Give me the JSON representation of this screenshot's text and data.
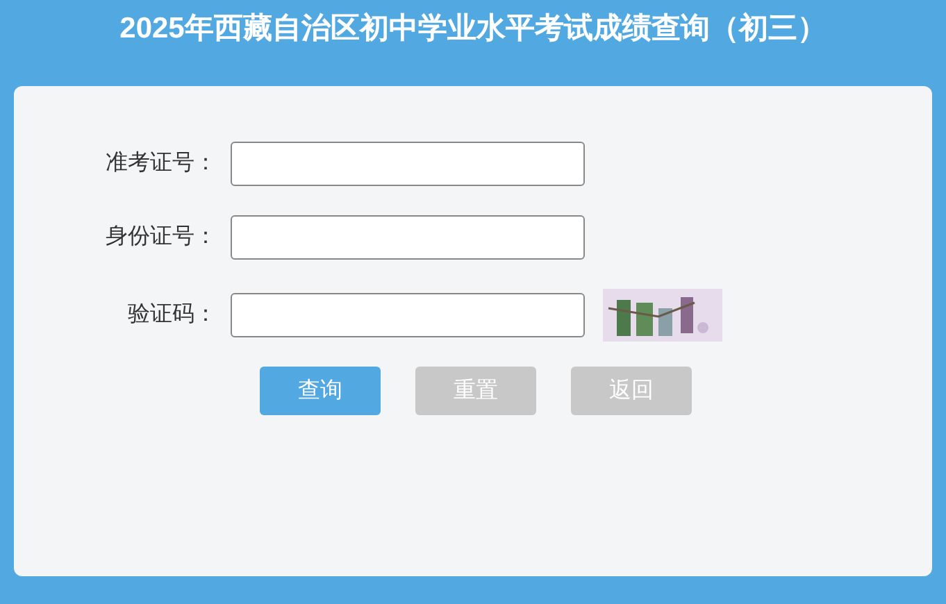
{
  "title": "2025年西藏自治区初中学业水平考试成绩查询（初三）",
  "fields": [
    {
      "label": "准考证号：",
      "kind": "text"
    },
    {
      "label": "身份证号：",
      "kind": "text"
    },
    {
      "label": "验证码：",
      "kind": "captcha"
    }
  ],
  "buttons": [
    {
      "label": "查询",
      "kind": "primary"
    },
    {
      "label": "重置",
      "kind": "secondary"
    },
    {
      "label": "返回",
      "kind": "secondary"
    }
  ]
}
